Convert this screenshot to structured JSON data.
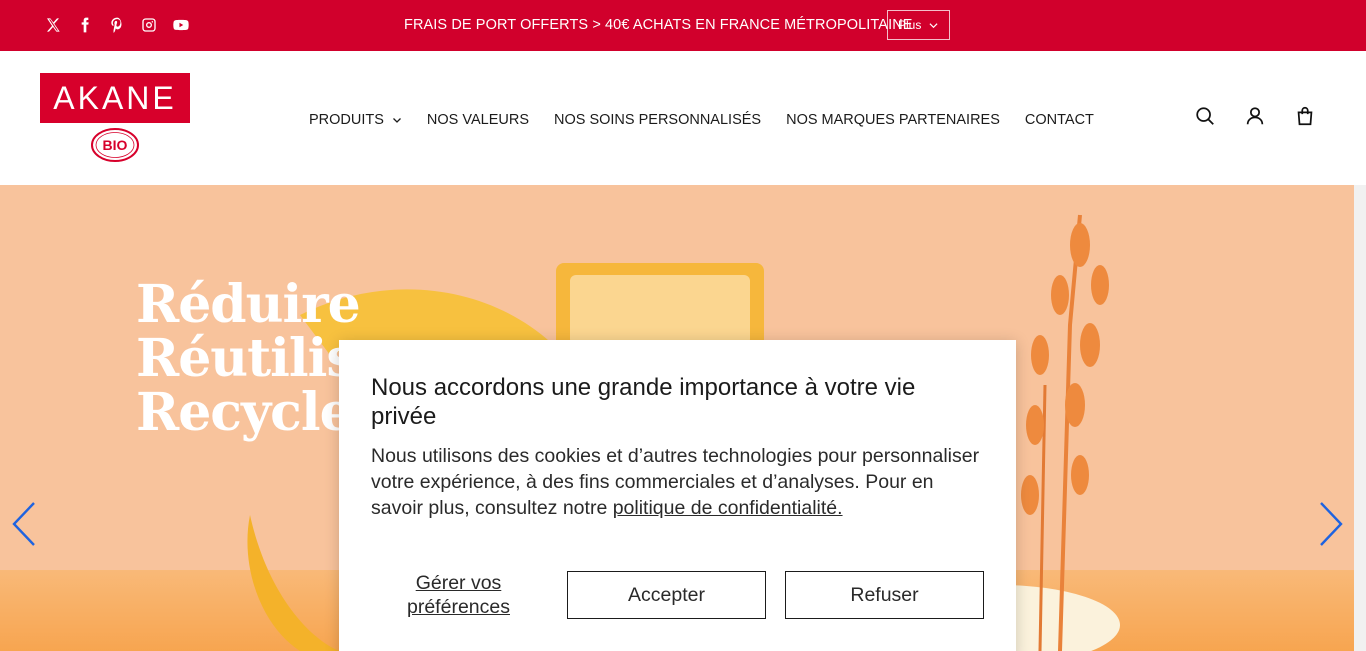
{
  "topbar": {
    "socials": [
      "x-twitter-icon",
      "facebook-icon",
      "pinterest-icon",
      "instagram-icon",
      "youtube-icon"
    ],
    "announcement": "FRAIS DE PORT OFFERTS > 40€ ACHATS EN FRANCE MÉTROPOLITAINE",
    "more_label": "Plus",
    "background": "#d1002c"
  },
  "header": {
    "logo_text": "AKANE",
    "logo_seal_text": "BIO",
    "nav": [
      {
        "label": "PRODUITS",
        "has_dropdown": true
      },
      {
        "label": "NOS VALEURS"
      },
      {
        "label": "NOS SOINS PERSONNALISÉS"
      },
      {
        "label": "NOS MARQUES PARTENAIRES"
      },
      {
        "label": "CONTACT"
      }
    ],
    "icons": [
      "search-icon",
      "account-icon",
      "cart-icon"
    ]
  },
  "hero": {
    "lines": [
      "Réduire",
      "Réutiliser",
      "Recycler"
    ],
    "arrow_color": "#1e63e0"
  },
  "cookie": {
    "title": "Nous accordons une grande importance à votre vie privée",
    "body": "Nous utilisons des cookies et d’autres technologies pour personnaliser votre expérience, à des fins commerciales et d’analyses. Pour en savoir plus, consultez notre ",
    "link": "politique de confidentialité.",
    "manage": "Gérer vos préférences",
    "accept": "Accepter",
    "refuse": "Refuser"
  }
}
